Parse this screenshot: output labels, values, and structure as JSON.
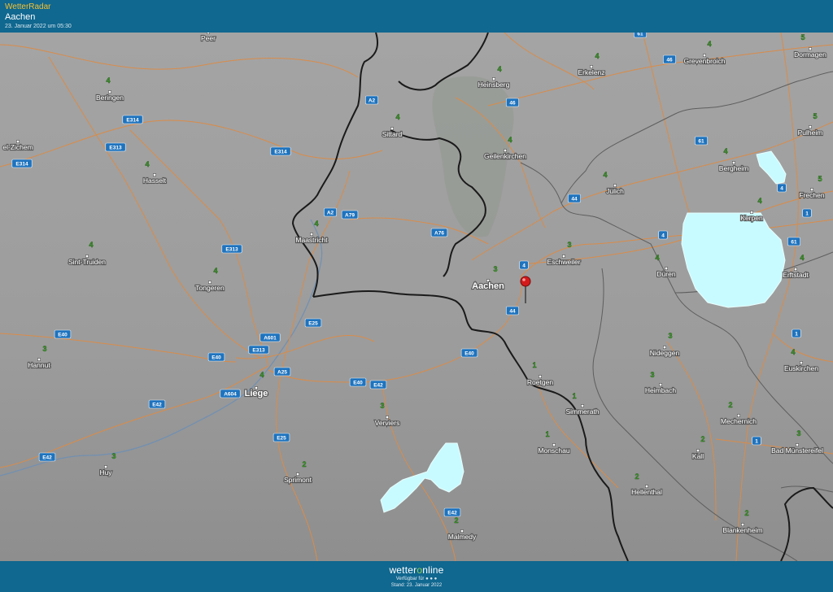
{
  "header": {
    "brand": "WetterRadar",
    "place": "Aachen",
    "timestamp": "23. Januar 2022 um 05:30"
  },
  "footer": {
    "logo_prefix": "wetter",
    "logo_o": "o",
    "logo_suffix": "nline",
    "availability": "Verfügbar für ● ● ●",
    "stand": "Stand: 23. Januar 2022"
  },
  "colors": {
    "header_bg": "#10678f",
    "precip": "#c8fbff",
    "road": "#d98c4a",
    "border": "#1a1a1a",
    "value": "#3fae2a"
  },
  "marker": {
    "icon": "map-pin-icon",
    "location": "Aachen"
  },
  "places": [
    {
      "name": "Peer",
      "value": ""
    },
    {
      "name": "Beringen",
      "value": "4"
    },
    {
      "name": "el-Zichem",
      "value": ""
    },
    {
      "name": "Hasselt",
      "value": "4"
    },
    {
      "name": "Sint-Truiden",
      "value": "4"
    },
    {
      "name": "Tongeren",
      "value": "4"
    },
    {
      "name": "Hannut",
      "value": "3"
    },
    {
      "name": "Huy",
      "value": "3"
    },
    {
      "name": "Liege",
      "value": "4"
    },
    {
      "name": "Sprimont",
      "value": "2"
    },
    {
      "name": "Verviers",
      "value": "3"
    },
    {
      "name": "Malmedy",
      "value": "2"
    },
    {
      "name": "Maastricht",
      "value": "4"
    },
    {
      "name": "Sittard",
      "value": "4"
    },
    {
      "name": "Heinsberg",
      "value": "4"
    },
    {
      "name": "Geilenkirchen",
      "value": "4"
    },
    {
      "name": "Erkelenz",
      "value": "4"
    },
    {
      "name": "Aachen",
      "value": "3"
    },
    {
      "name": "Eschweiler",
      "value": "3"
    },
    {
      "name": "Jülich",
      "value": "4"
    },
    {
      "name": "Roetgen",
      "value": "1"
    },
    {
      "name": "Simmerath",
      "value": "1"
    },
    {
      "name": "Monschau",
      "value": "1"
    },
    {
      "name": "Düren",
      "value": "4"
    },
    {
      "name": "Nideggen",
      "value": "3"
    },
    {
      "name": "Heimbach",
      "value": "3"
    },
    {
      "name": "Hellenthal",
      "value": "2"
    },
    {
      "name": "Grevenbroich",
      "value": "4"
    },
    {
      "name": "Dormagen",
      "value": "5"
    },
    {
      "name": "Pulheim",
      "value": "5"
    },
    {
      "name": "Bergheim",
      "value": "4"
    },
    {
      "name": "Kerpen",
      "value": "4"
    },
    {
      "name": "Frechen",
      "value": "5"
    },
    {
      "name": "Erftstadt",
      "value": "4"
    },
    {
      "name": "Euskirchen",
      "value": "4"
    },
    {
      "name": "Mechernich",
      "value": "2"
    },
    {
      "name": "Kall",
      "value": "2"
    },
    {
      "name": "Bad Münstereifel",
      "value": "3"
    },
    {
      "name": "Blankenheim",
      "value": "2"
    }
  ],
  "road_labels": [
    "E314",
    "E313",
    "E314",
    "E314",
    "A2",
    "A2",
    "A79",
    "E313",
    "A76",
    "A601",
    "E25",
    "E313",
    "E40",
    "E40",
    "A25",
    "A604",
    "E42",
    "E42",
    "E40",
    "E40",
    "E25",
    "E42",
    "E42",
    "44",
    "44",
    "4",
    "46",
    "61",
    "46",
    "61",
    "4",
    "4",
    "1",
    "61",
    "1",
    "1"
  ]
}
